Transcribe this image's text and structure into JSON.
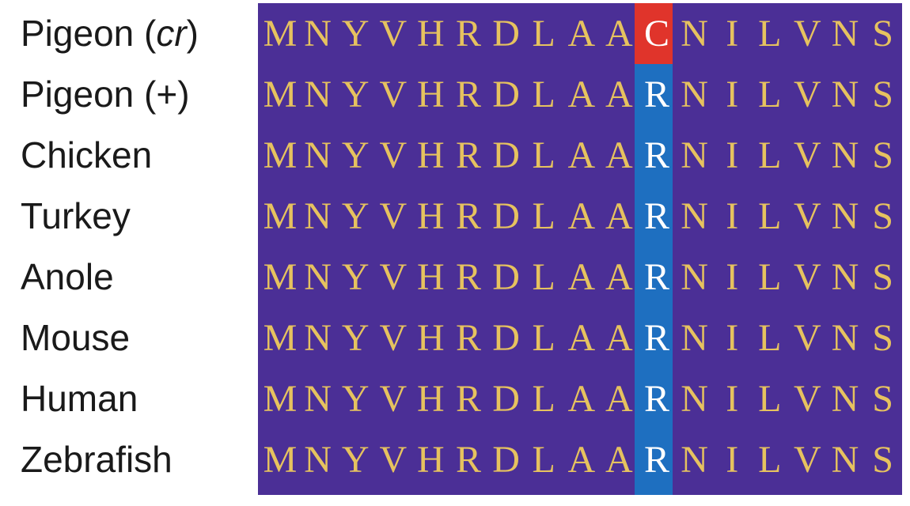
{
  "species": [
    {
      "name": "Pigeon",
      "suffix_italic": "cr",
      "display": "Pigeon (cr)"
    },
    {
      "name": "Pigeon (+)"
    },
    {
      "name": "Chicken"
    },
    {
      "name": "Turkey"
    },
    {
      "name": "Anole"
    },
    {
      "name": "Mouse"
    },
    {
      "name": "Human"
    },
    {
      "name": "Zebrafish"
    }
  ],
  "sequences": [
    "MNYVHRDLAACNILVNS",
    "MNYVHRDLAARNILVNS",
    "MNYVHRDLAARNILVNS",
    "MNYVHRDLAARNILVNS",
    "MNYVHRDLAARNILVNS",
    "MNYVHRDLAARNILVNS",
    "MNYVHRDLAARNILVNS",
    "MNYVHRDLAARNILVNS"
  ],
  "highlight_column_index": 10,
  "colors": {
    "panel_background": "#4b2f96",
    "residue_text": "#e6c25f",
    "highlight_residue_text": "#ffffff",
    "mutant_highlight": "#e0342b",
    "conserved_highlight": "#1e6fc0",
    "label_text": "#1a1a1a"
  }
}
